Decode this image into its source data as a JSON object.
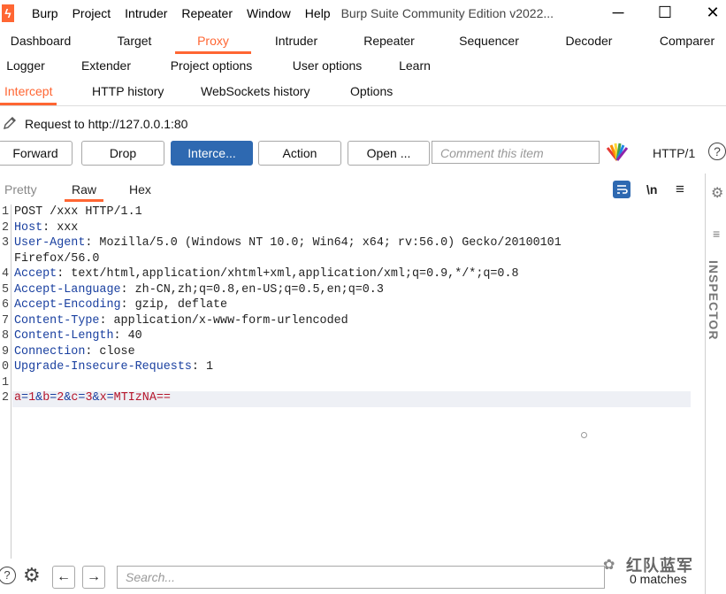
{
  "window": {
    "title": "Burp Suite Community Edition v2022...",
    "menu": [
      "Burp",
      "Project",
      "Intruder",
      "Repeater",
      "Window",
      "Help"
    ],
    "controls": {
      "minimize": "─",
      "maximize": "☐",
      "close": "✕"
    }
  },
  "main_tabs": {
    "row1": [
      "Dashboard",
      "Target",
      "Proxy",
      "Intruder",
      "Repeater",
      "Sequencer",
      "Decoder",
      "Comparer"
    ],
    "row2": [
      "Logger",
      "Extender",
      "Project options",
      "User options",
      "Learn"
    ],
    "active": "Proxy"
  },
  "proxy_tabs": {
    "items": [
      "Intercept",
      "HTTP history",
      "WebSockets history",
      "Options"
    ],
    "active": "Intercept"
  },
  "request_info": {
    "label": "Request to http://127.0.0.1:80"
  },
  "toolbar": {
    "forward": "Forward",
    "drop": "Drop",
    "intercept": "Interce...",
    "action": "Action",
    "open": "Open ...",
    "comment_placeholder": "Comment this item",
    "protocol": "HTTP/1",
    "help": "?"
  },
  "editor_tabs": {
    "items": [
      "Pretty",
      "Raw",
      "Hex"
    ],
    "active": "Raw",
    "newline_toggle": "\\n",
    "menu": "≡"
  },
  "request": {
    "lines": [
      {
        "n": "1",
        "text": "POST /xxx HTTP/1.1"
      },
      {
        "n": "2",
        "key": "Host",
        "value": ": xxx"
      },
      {
        "n": "3",
        "key": "User-Agent",
        "value": ": Mozilla/5.0 (Windows NT 10.0; Win64; x64; rv:56.0) Gecko/20100101"
      },
      {
        "n": "",
        "text": "Firefox/56.0"
      },
      {
        "n": "4",
        "key": "Accept",
        "value": ": text/html,application/xhtml+xml,application/xml;q=0.9,*/*;q=0.8"
      },
      {
        "n": "5",
        "key": "Accept-Language",
        "value": ": zh-CN,zh;q=0.8,en-US;q=0.5,en;q=0.3"
      },
      {
        "n": "6",
        "key": "Accept-Encoding",
        "value": ": gzip, deflate"
      },
      {
        "n": "7",
        "key": "Content-Type",
        "value": ": application/x-www-form-urlencoded"
      },
      {
        "n": "8",
        "key": "Content-Length",
        "value": ": 40"
      },
      {
        "n": "9",
        "key": "Connection",
        "value": ": close"
      },
      {
        "n": "0",
        "key": "Upgrade-Insecure-Requests",
        "value": ": 1"
      },
      {
        "n": "1",
        "text": ""
      },
      {
        "n": "2",
        "body": [
          {
            "k": "a",
            "v": "1"
          },
          {
            "k": "b",
            "v": "2"
          },
          {
            "k": "c",
            "v": "3"
          },
          {
            "k": "x",
            "v": "MTIzNA=="
          }
        ]
      }
    ]
  },
  "inspector": {
    "label": "INSPECTOR"
  },
  "bottom": {
    "search_placeholder": "Search...",
    "matches": "0 matches",
    "watermark": "红队蓝军"
  },
  "colors": {
    "accent": "#ff6633",
    "primary_button": "#2e69b1",
    "header_key": "#1a40a0",
    "body_key": "#b5152b",
    "body_value": "#b5152b",
    "body_sep": "#1a40a0"
  }
}
